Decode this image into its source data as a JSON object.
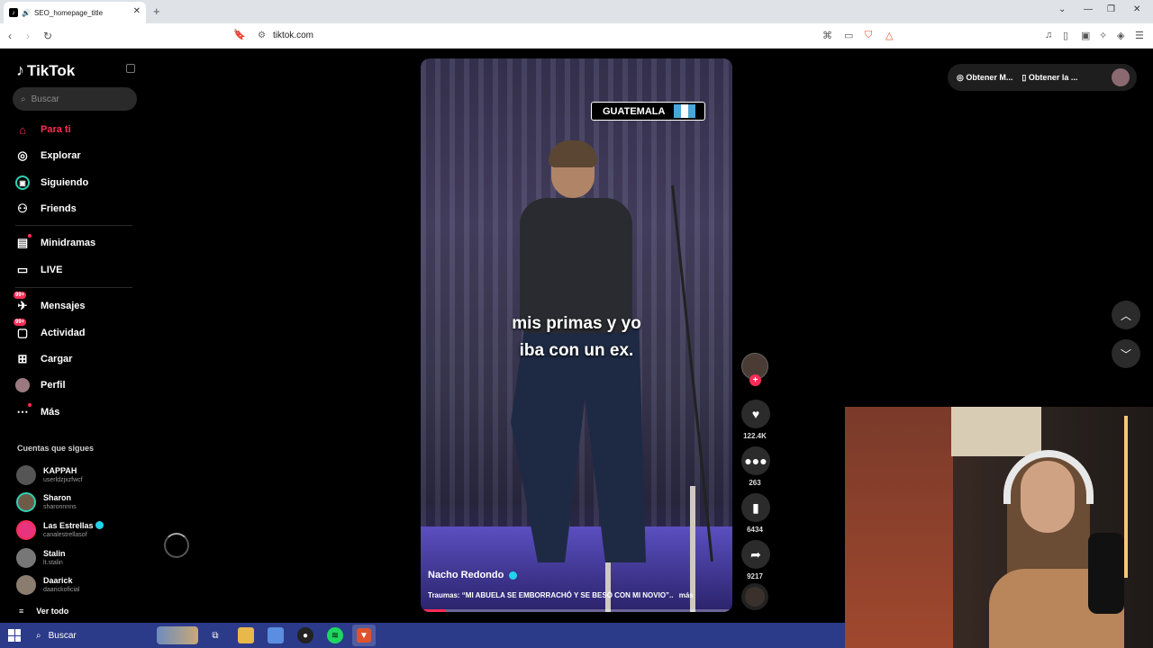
{
  "browser": {
    "tab_title": "SEO_homepage_title",
    "url": "tiktok.com"
  },
  "sidebar": {
    "logo": "TikTok",
    "search_placeholder": "Buscar",
    "menu": [
      {
        "label": "Para ti",
        "icon": "home-icon"
      },
      {
        "label": "Explorar",
        "icon": "compass-icon"
      },
      {
        "label": "Siguiendo",
        "icon": "following-icon"
      },
      {
        "label": "Friends",
        "icon": "friends-icon"
      },
      {
        "label": "Minidramas",
        "icon": "minidramas-icon"
      },
      {
        "label": "LIVE",
        "icon": "live-icon"
      },
      {
        "label": "Mensajes",
        "icon": "messages-icon",
        "badge": "99+"
      },
      {
        "label": "Actividad",
        "icon": "activity-icon",
        "badge": "99+"
      },
      {
        "label": "Cargar",
        "icon": "upload-icon"
      },
      {
        "label": "Perfil",
        "icon": "profile-avatar"
      },
      {
        "label": "Más",
        "icon": "more-icon"
      }
    ],
    "following_title": "Cuentas que sigues",
    "following": [
      {
        "name": "KAPPAH",
        "username": "userldzjxzfwcf"
      },
      {
        "name": "Sharon",
        "username": "sharonnnns"
      },
      {
        "name": "Las Estrellas",
        "username": "canalestrellasof",
        "verified": true
      },
      {
        "name": "Stalin",
        "username": "lt.stalin"
      },
      {
        "name": "Daarick",
        "username": "daarickoficial"
      }
    ],
    "see_all": "Ver todo"
  },
  "video": {
    "overlay_tag": "GUATEMALA",
    "caption_line1": "mis primas y yo",
    "caption_line2": "iba con un ex.",
    "author": "Nacho Redondo",
    "description": "Traumas: “MI ABUELA SE EMBORRACHÓ Y SE BESÓ CON MI NOVIO”..",
    "more": "más",
    "progress": 0.08
  },
  "actions": {
    "likes": "122.4K",
    "comments": "263",
    "saves": "6434",
    "shares": "9217"
  },
  "topbar": {
    "get_coins": "Obtener M...",
    "get_app": "Obtener la ..."
  },
  "taskbar": {
    "search_label": "Buscar"
  },
  "colors": {
    "accent": "#fe2c55",
    "verified": "#20d5ec",
    "taskbar": "#2c3a8a"
  }
}
